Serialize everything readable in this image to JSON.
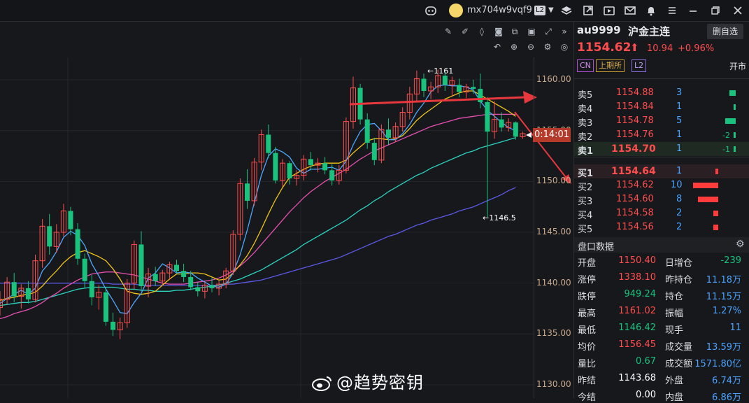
{
  "topbar": {
    "username": "mx704w9vqf9",
    "level_badge": "L2",
    "icons": [
      "robot-icon",
      "avatar",
      "layers-icon",
      "export-icon",
      "video-icon",
      "mail-icon",
      "bell-icon",
      "menu-icon",
      "minimize-icon",
      "restore-icon",
      "close-icon"
    ]
  },
  "toolbar": {
    "row1": [
      "edit-icon",
      "pen-icon",
      "drop-icon",
      "camera-icon",
      "copy-icon",
      "image-icon",
      "expand-icon",
      "collapse-icon"
    ],
    "row2": [
      "undo-icon",
      "zoom-in-icon",
      "zoom-out-icon",
      "settings-icon"
    ]
  },
  "chart": {
    "price_axis_labels": [
      "1160.00",
      "1155.00",
      "1150.00",
      "1145.00",
      "1140.00",
      "1135.00",
      "1130.00"
    ],
    "high_marker": "←1161",
    "low_marker": "←1146.5",
    "countdown": "0:14:01",
    "watermark": "@趋势密钥",
    "colors": {
      "up": "#ff4d4d",
      "down": "#19c37d",
      "ma5": "#4ea8ff",
      "ma10": "#f0c419",
      "ma20": "#e64fb0",
      "ma40": "#2bd3c0",
      "ma60": "#5b58e6",
      "arrow": "#e8383d",
      "bg": "#17181c"
    }
  },
  "chart_data": {
    "type": "candlestick",
    "ylim": [
      1129,
      1162
    ],
    "yticks": [
      1130,
      1135,
      1140,
      1145,
      1150,
      1155,
      1160
    ],
    "ohlc": [
      [
        1137.6,
        1139.2,
        1136.8,
        1138.4
      ],
      [
        1138.4,
        1140.6,
        1137.9,
        1140.1
      ],
      [
        1140.1,
        1141.0,
        1138.1,
        1138.7
      ],
      [
        1138.7,
        1139.9,
        1137.5,
        1139.5
      ],
      [
        1139.5,
        1140.2,
        1138.0,
        1138.4
      ],
      [
        1138.4,
        1142.8,
        1138.1,
        1142.2
      ],
      [
        1142.2,
        1146.3,
        1141.5,
        1145.6
      ],
      [
        1145.6,
        1146.8,
        1142.8,
        1143.6
      ],
      [
        1143.6,
        1145.8,
        1143.0,
        1145.0
      ],
      [
        1145.0,
        1147.8,
        1144.6,
        1147.1
      ],
      [
        1147.1,
        1147.5,
        1144.7,
        1145.3
      ],
      [
        1145.3,
        1145.9,
        1141.8,
        1142.4
      ],
      [
        1142.4,
        1142.9,
        1139.5,
        1140.2
      ],
      [
        1140.2,
        1140.8,
        1137.8,
        1138.6
      ],
      [
        1138.6,
        1139.8,
        1137.4,
        1139.1
      ],
      [
        1139.1,
        1139.5,
        1135.8,
        1136.2
      ],
      [
        1136.2,
        1137.1,
        1134.8,
        1135.4
      ],
      [
        1135.4,
        1136.6,
        1134.5,
        1136.1
      ],
      [
        1136.1,
        1140.4,
        1135.6,
        1140.0
      ],
      [
        1140.0,
        1144.2,
        1139.4,
        1143.8
      ],
      [
        1143.8,
        1145.1,
        1139.2,
        1139.7
      ],
      [
        1139.7,
        1141.5,
        1138.6,
        1140.9
      ],
      [
        1140.9,
        1141.6,
        1139.7,
        1140.2
      ],
      [
        1140.2,
        1141.3,
        1139.8,
        1141.0
      ],
      [
        1141.0,
        1142.1,
        1140.3,
        1141.8
      ],
      [
        1141.8,
        1142.3,
        1140.9,
        1141.2
      ],
      [
        1141.2,
        1141.9,
        1140.1,
        1140.6
      ],
      [
        1140.6,
        1141.2,
        1139.3,
        1139.6
      ],
      [
        1139.6,
        1140.1,
        1138.7,
        1139.2
      ],
      [
        1139.2,
        1140.1,
        1138.5,
        1139.8
      ],
      [
        1139.8,
        1140.5,
        1139.1,
        1139.5
      ],
      [
        1139.5,
        1140.2,
        1138.8,
        1139.9
      ],
      [
        1139.9,
        1141.5,
        1139.5,
        1141.2
      ],
      [
        1141.2,
        1145.2,
        1140.8,
        1144.8
      ],
      [
        1144.8,
        1150.3,
        1144.2,
        1149.8
      ],
      [
        1149.8,
        1151.2,
        1147.3,
        1148.1
      ],
      [
        1148.1,
        1152.3,
        1147.6,
        1151.9
      ],
      [
        1151.9,
        1155.1,
        1151.1,
        1154.6
      ],
      [
        1154.6,
        1155.6,
        1152.3,
        1152.8
      ],
      [
        1152.8,
        1153.4,
        1149.8,
        1150.1
      ],
      [
        1150.1,
        1152.2,
        1149.5,
        1151.8
      ],
      [
        1151.8,
        1152.0,
        1149.7,
        1150.3
      ],
      [
        1150.3,
        1151.1,
        1149.6,
        1150.6
      ],
      [
        1150.6,
        1152.6,
        1150.1,
        1152.2
      ],
      [
        1152.2,
        1152.9,
        1151.1,
        1151.6
      ],
      [
        1151.6,
        1152.3,
        1150.9,
        1151.8
      ],
      [
        1151.8,
        1152.4,
        1150.7,
        1151.1
      ],
      [
        1151.1,
        1151.7,
        1149.6,
        1150.1
      ],
      [
        1150.1,
        1151.6,
        1149.7,
        1151.1
      ],
      [
        1151.1,
        1156.3,
        1150.8,
        1155.9
      ],
      [
        1155.9,
        1160.3,
        1155.2,
        1159.2
      ],
      [
        1159.2,
        1159.6,
        1155.6,
        1156.1
      ],
      [
        1156.1,
        1156.7,
        1153.2,
        1153.8
      ],
      [
        1153.8,
        1154.3,
        1151.6,
        1152.1
      ],
      [
        1152.1,
        1155.6,
        1151.8,
        1155.1
      ],
      [
        1155.1,
        1156.2,
        1153.6,
        1154.3
      ],
      [
        1154.3,
        1155.8,
        1153.9,
        1155.4
      ],
      [
        1155.4,
        1157.3,
        1154.9,
        1156.8
      ],
      [
        1156.8,
        1159.3,
        1156.1,
        1158.6
      ],
      [
        1158.6,
        1160.9,
        1157.9,
        1160.1
      ],
      [
        1160.1,
        1160.6,
        1158.3,
        1158.9
      ],
      [
        1158.9,
        1159.8,
        1158.1,
        1159.3
      ],
      [
        1159.3,
        1161.0,
        1158.7,
        1160.4
      ],
      [
        1160.4,
        1160.8,
        1158.9,
        1159.5
      ],
      [
        1159.5,
        1160.3,
        1158.4,
        1159.9
      ],
      [
        1159.5,
        1160.1,
        1158.3,
        1158.8
      ],
      [
        1158.8,
        1159.6,
        1158.2,
        1159.3
      ],
      [
        1159.3,
        1160.0,
        1158.6,
        1159.1
      ],
      [
        1159.1,
        1160.6,
        1157.2,
        1157.8
      ],
      [
        1157.8,
        1158.3,
        1146.5,
        1154.9
      ],
      [
        1154.9,
        1157.9,
        1154.2,
        1156.1
      ],
      [
        1156.1,
        1156.8,
        1154.9,
        1155.3
      ],
      [
        1155.3,
        1156.2,
        1154.9,
        1155.8
      ],
      [
        1155.8,
        1155.9,
        1154.1,
        1154.4
      ],
      [
        1154.4,
        1154.9,
        1154.2,
        1154.7
      ]
    ],
    "ma5": [
      1138.0,
      1138.5,
      1138.9,
      1139.3,
      1138.9,
      1139.5,
      1141.2,
      1142.0,
      1143.1,
      1144.5,
      1145.1,
      1144.7,
      1143.7,
      1141.9,
      1140.7,
      1139.4,
      1138.3,
      1137.1,
      1137.0,
      1138.1,
      1139.0,
      1140.5,
      1141.0,
      1141.9,
      1141.5,
      1141.0,
      1141.1,
      1141.0,
      1140.5,
      1140.1,
      1139.7,
      1139.6,
      1139.9,
      1141.0,
      1142.8,
      1145.2,
      1147.9,
      1150.6,
      1152.5,
      1153.2,
      1152.9,
      1152.4,
      1151.3,
      1150.8,
      1151.2,
      1151.2,
      1151.3,
      1151.4,
      1151.1,
      1152.0,
      1153.6,
      1154.9,
      1155.6,
      1155.7,
      1155.0,
      1154.1,
      1154.1,
      1154.7,
      1155.6,
      1156.8,
      1157.7,
      1158.8,
      1159.4,
      1159.5,
      1159.4,
      1159.4,
      1159.3,
      1159.0,
      1157.9,
      1157.0,
      1156.4,
      1155.8,
      1155.3,
      1155.0
    ],
    "ma10": [
      1138.3,
      1138.5,
      1138.6,
      1138.8,
      1138.9,
      1139.1,
      1139.7,
      1140.5,
      1141.2,
      1142.0,
      1142.6,
      1143.0,
      1143.2,
      1142.9,
      1142.6,
      1142.2,
      1141.4,
      1140.4,
      1139.2,
      1139.0,
      1138.9,
      1139.0,
      1139.2,
      1139.8,
      1140.4,
      1140.9,
      1140.9,
      1141.0,
      1141.0,
      1140.9,
      1140.6,
      1140.3,
      1140.4,
      1141.0,
      1141.8,
      1142.7,
      1143.9,
      1145.3,
      1146.8,
      1148.2,
      1149.4,
      1150.4,
      1150.8,
      1151.2,
      1151.5,
      1151.7,
      1151.8,
      1151.8,
      1151.8,
      1152.1,
      1152.8,
      1153.4,
      1154.0,
      1154.2,
      1154.2,
      1154.1,
      1154.2,
      1154.5,
      1155.2,
      1156.0,
      1156.6,
      1157.1,
      1157.6,
      1158.1,
      1158.4,
      1158.7,
      1158.9,
      1158.9,
      1158.5,
      1158.1,
      1157.7,
      1157.3,
      1156.9,
      1156.4
    ],
    "ma20": [
      1136.5,
      1136.7,
      1137.0,
      1137.2,
      1137.4,
      1137.7,
      1138.1,
      1138.6,
      1139.0,
      1139.5,
      1139.9,
      1140.3,
      1140.6,
      1140.9,
      1141.0,
      1141.1,
      1141.1,
      1141.0,
      1140.9,
      1140.8,
      1140.6,
      1140.4,
      1140.2,
      1140.0,
      1139.9,
      1139.9,
      1139.9,
      1140.0,
      1140.1,
      1140.2,
      1140.3,
      1140.5,
      1140.8,
      1141.2,
      1141.7,
      1142.3,
      1143.0,
      1143.8,
      1144.6,
      1145.4,
      1146.2,
      1147.0,
      1147.7,
      1148.4,
      1149.0,
      1149.5,
      1150.0,
      1150.4,
      1150.8,
      1151.2,
      1151.7,
      1152.2,
      1152.6,
      1153.0,
      1153.3,
      1153.6,
      1153.9,
      1154.2,
      1154.5,
      1154.8,
      1155.1,
      1155.4,
      1155.6,
      1155.8,
      1156.0,
      1156.2,
      1156.3,
      1156.4,
      1156.5,
      1156.6,
      1156.6,
      1156.6,
      1156.6,
      1156.6
    ],
    "ma40": [
      1137.8,
      1137.9,
      1138.0,
      1138.1,
      1138.1,
      1138.2,
      1138.4,
      1138.6,
      1138.8,
      1139.0,
      1139.2,
      1139.4,
      1139.5,
      1139.6,
      1139.6,
      1139.6,
      1139.6,
      1139.5,
      1139.4,
      1139.4,
      1139.3,
      1139.3,
      1139.2,
      1139.2,
      1139.2,
      1139.3,
      1139.3,
      1139.4,
      1139.5,
      1139.6,
      1139.7,
      1139.8,
      1140.0,
      1140.2,
      1140.4,
      1140.7,
      1141.0,
      1141.3,
      1141.7,
      1142.1,
      1142.5,
      1142.9,
      1143.3,
      1143.8,
      1144.2,
      1144.6,
      1145.0,
      1145.4,
      1145.8,
      1146.2,
      1146.7,
      1147.2,
      1147.6,
      1148.1,
      1148.5,
      1149.0,
      1149.4,
      1149.8,
      1150.2,
      1150.6,
      1150.9,
      1151.3,
      1151.6,
      1151.9,
      1152.2,
      1152.5,
      1152.8,
      1153.0,
      1153.3,
      1153.5,
      1153.7,
      1153.9,
      1154.1,
      1154.3
    ],
    "ma60": [
      1140.0,
      1140.0,
      1140.0,
      1140.0,
      1140.0,
      1140.0,
      1140.0,
      1140.0,
      1140.0,
      1140.0,
      1140.0,
      1140.0,
      1140.0,
      1140.0,
      1140.0,
      1140.0,
      1139.9,
      1139.9,
      1139.9,
      1139.9,
      1139.8,
      1139.8,
      1139.8,
      1139.8,
      1139.8,
      1139.8,
      1139.8,
      1139.8,
      1139.8,
      1139.8,
      1139.8,
      1139.8,
      1139.9,
      1139.9,
      1140.0,
      1140.1,
      1140.2,
      1140.3,
      1140.5,
      1140.7,
      1140.9,
      1141.1,
      1141.3,
      1141.5,
      1141.7,
      1141.9,
      1142.1,
      1142.3,
      1142.5,
      1142.8,
      1143.1,
      1143.4,
      1143.7,
      1144.0,
      1144.3,
      1144.6,
      1144.8,
      1145.1,
      1145.4,
      1145.7,
      1145.9,
      1146.2,
      1146.4,
      1146.6,
      1146.8,
      1147.1,
      1147.3,
      1147.5,
      1147.8,
      1148.1,
      1148.4,
      1148.7,
      1149.1,
      1149.4
    ]
  },
  "panel": {
    "symbol": "au9999",
    "name": "沪金主连",
    "watch_button": "删自选",
    "price": "1154.62",
    "arrow": "⬆",
    "change": "10.94",
    "change_pct": "+0.96%",
    "tags": [
      "CN",
      "上期所",
      "L2"
    ],
    "status": "开市",
    "asks": [
      {
        "label": "卖5",
        "price": "1154.88",
        "qty": "3",
        "delta": "",
        "bar": 0.3
      },
      {
        "label": "卖4",
        "price": "1154.84",
        "qty": "1",
        "delta": "",
        "bar": 0.1
      },
      {
        "label": "卖3",
        "price": "1154.78",
        "qty": "5",
        "delta": "",
        "bar": 0.5
      },
      {
        "label": "卖2",
        "price": "1154.76",
        "qty": "1",
        "delta": "-2",
        "bar": 0.1
      },
      {
        "label": "卖1",
        "price": "1154.70",
        "qty": "1",
        "delta": "-1",
        "bar": 0.1
      }
    ],
    "bids": [
      {
        "label": "买1",
        "price": "1154.64",
        "qty": "1",
        "bar": 0.1
      },
      {
        "label": "买2",
        "price": "1154.62",
        "qty": "10",
        "bar": 1.0
      },
      {
        "label": "买3",
        "price": "1154.60",
        "qty": "8",
        "bar": 0.8
      },
      {
        "label": "买4",
        "price": "1154.58",
        "qty": "2",
        "bar": 0.2
      },
      {
        "label": "买5",
        "price": "1154.56",
        "qty": "2",
        "bar": 0.2
      }
    ],
    "section_title": "盘口数据",
    "stats": [
      {
        "l1": "开盘",
        "v1": "1150.40",
        "l2": "日增仓",
        "v2": "-239"
      },
      {
        "l1": "涨停",
        "v1": "1338.10",
        "l2": "昨持仓",
        "v2": "11.18万"
      },
      {
        "l1": "跌停",
        "v1": "949.24",
        "l2": "持仓",
        "v2": "11.15万"
      },
      {
        "l1": "最高",
        "v1": "1161.02",
        "l2": "振幅",
        "v2": "1.27%"
      },
      {
        "l1": "最低",
        "v1": "1146.42",
        "l2": "现手",
        "v2": "11"
      },
      {
        "l1": "均价",
        "v1": "1156.45",
        "l2": "成交量",
        "v2": "13.59万"
      },
      {
        "l1": "量比",
        "v1": "0.67",
        "l2": "成交额",
        "v2": "1571.80亿"
      },
      {
        "l1": "昨结",
        "v1": "1143.68",
        "l2": "外盘",
        "v2": "6.74万"
      },
      {
        "l1": "今结",
        "v1": "0.00",
        "l2": "内盘",
        "v2": "6.86万"
      }
    ]
  }
}
